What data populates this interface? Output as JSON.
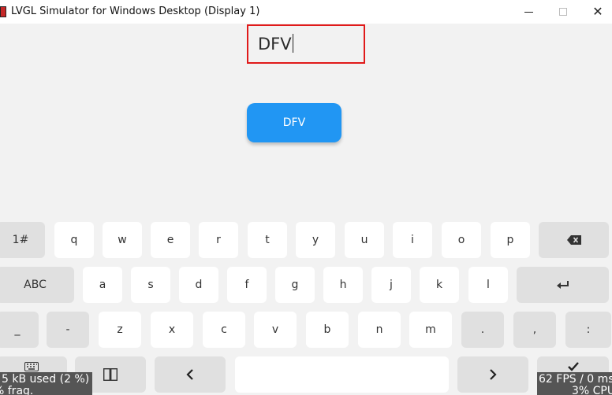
{
  "window": {
    "title": "LVGL Simulator for Windows Desktop (Display 1)",
    "controls": {
      "minimize_icon": "minimize-icon",
      "maximize_icon": "maximize-icon",
      "close_icon": "close-icon",
      "close_glyph": "✕"
    }
  },
  "textarea": {
    "value": "DFV",
    "border_color": "#e01a1a"
  },
  "button": {
    "label": "DFV",
    "color": "#2196f3"
  },
  "keyboard": {
    "row1": [
      "1#",
      "q",
      "w",
      "e",
      "r",
      "t",
      "y",
      "u",
      "i",
      "o",
      "p",
      "backspace-icon"
    ],
    "row2": [
      "ABC",
      "a",
      "s",
      "d",
      "f",
      "g",
      "h",
      "j",
      "k",
      "l",
      "enter-icon"
    ],
    "row3": [
      "_",
      "-",
      "z",
      "x",
      "c",
      "v",
      "b",
      "n",
      "m",
      ".",
      ",",
      ":"
    ],
    "row4": [
      "keyboard-icon",
      "text-direction-icon",
      "arrow-left-icon",
      "space",
      "arrow-right-icon",
      "ok-icon"
    ],
    "labels": {
      "k1": "1#",
      "q": "q",
      "w": "w",
      "e": "e",
      "r": "r",
      "t": "t",
      "y": "y",
      "u": "u",
      "i": "i",
      "o": "o",
      "p": "p",
      "abc": "ABC",
      "a": "a",
      "s": "s",
      "d": "d",
      "f": "f",
      "g": "g",
      "h": "h",
      "j": "j",
      "k": "k",
      "l": "l",
      "underscore": "_",
      "dash": "-",
      "z": "z",
      "x": "x",
      "c": "c",
      "v": "v",
      "b": "b",
      "n": "n",
      "m": "m",
      "dot": ".",
      "comma": ",",
      "colon": ":"
    }
  },
  "monitor": {
    "memory_line1": "5 kB used (2 %)",
    "memory_line2": "% frag.",
    "perf_line1": "62 FPS / 0 ms",
    "perf_line2": "3% CPU"
  }
}
